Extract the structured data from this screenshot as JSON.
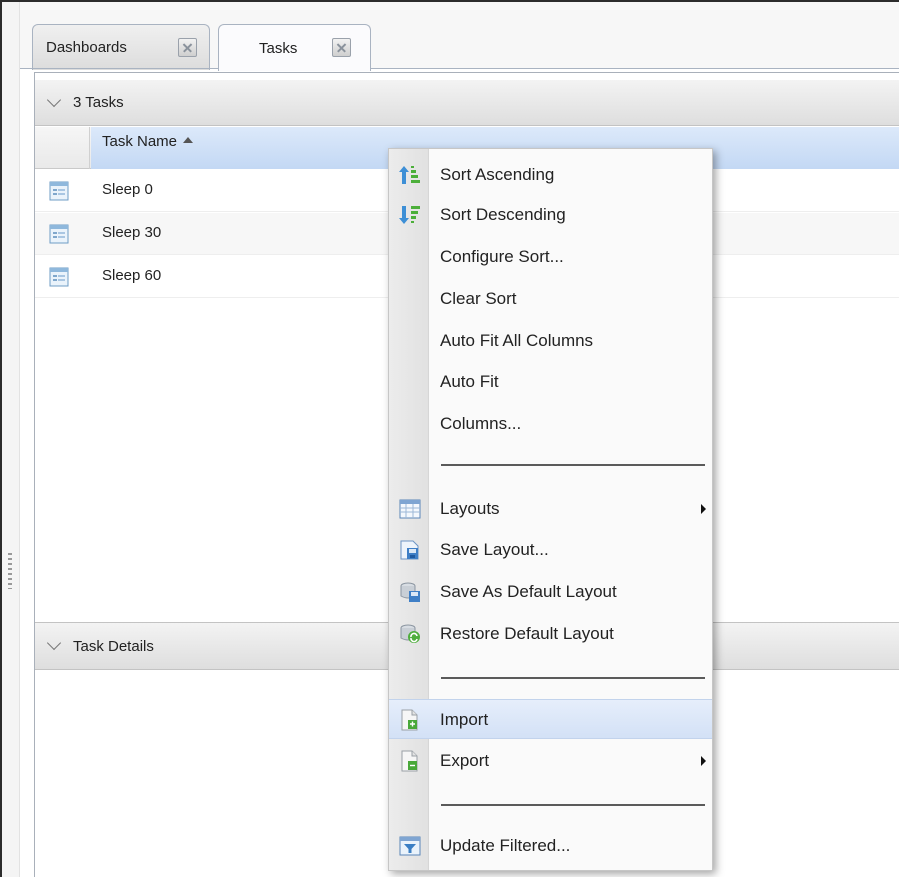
{
  "tabs": [
    {
      "label": "Dashboards",
      "active": false
    },
    {
      "label": "Tasks",
      "active": true
    }
  ],
  "tasks_section": {
    "title": "3 Tasks",
    "column_header": "Task Name",
    "rows": [
      "Sleep 0",
      "Sleep 30",
      "Sleep 60"
    ]
  },
  "details_section": {
    "title": "Task Details"
  },
  "context_menu": {
    "items": [
      {
        "label": "Sort Ascending",
        "icon": "sort-ascending-icon"
      },
      {
        "label": "Sort Descending",
        "icon": "sort-descending-icon"
      },
      {
        "label": "Configure Sort..."
      },
      {
        "label": "Clear Sort"
      },
      {
        "label": "Auto Fit All Columns"
      },
      {
        "label": "Auto Fit"
      },
      {
        "label": "Columns..."
      },
      {
        "label": "Layouts",
        "icon": "layouts-icon",
        "submenu": true
      },
      {
        "label": "Save Layout...",
        "icon": "save-layout-icon"
      },
      {
        "label": "Save As Default Layout",
        "icon": "save-default-layout-icon"
      },
      {
        "label": "Restore Default Layout",
        "icon": "restore-layout-icon"
      },
      {
        "label": "Import",
        "icon": "import-icon",
        "highlighted": true
      },
      {
        "label": "Export",
        "icon": "export-icon",
        "submenu": true
      },
      {
        "label": "Update Filtered...",
        "icon": "update-filtered-icon"
      }
    ]
  },
  "colors": {
    "column_header_selected": "#c9dcf5",
    "menu_highlight": "#dbe6f8",
    "tab_border": "#a9b3c1"
  }
}
